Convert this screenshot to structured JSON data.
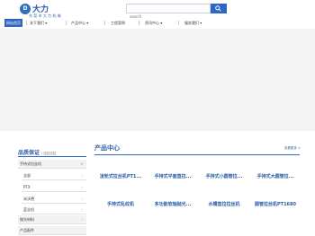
{
  "header": {
    "logo_mark": "D",
    "brand": "大力",
    "tagline": "东 莞 市 大 力 机 械"
  },
  "search": {
    "placeholder": "search"
  },
  "nav": {
    "items": [
      {
        "label": "网站首页",
        "active": true
      },
      {
        "label": "关于我们",
        "dropdown": true
      },
      {
        "label": "产品中心",
        "dropdown": true
      },
      {
        "label": "工程案例"
      },
      {
        "label": "资讯中心",
        "dropdown": true
      },
      {
        "label": "服务我们",
        "dropdown": true
      }
    ]
  },
  "sidebar": {
    "title": "品质保证",
    "subtitle": "/ 拉拉拉拉",
    "rows": [
      {
        "label": "手持式拉丝机",
        "arrow": "▾"
      },
      {
        "label": "全部",
        "arrow": "›"
      },
      {
        "label": "PTX",
        "arrow": "›"
      },
      {
        "label": "米沃德",
        "arrow": "›"
      },
      {
        "label": "拉丝",
        "arrow": "›"
      },
      {
        "label": "蓝全机",
        "arrow": "›"
      },
      {
        "label": "抛光材料",
        "arrow": "›"
      },
      {
        "label": "产品配件",
        "arrow": ""
      }
    ]
  },
  "products": {
    "title": "产品中心",
    "more": "查看更多 >",
    "items": [
      "凌轮式拉丝机PT1...",
      "手持式平面直拉...",
      "手持式小圆管拉...",
      "手持式大圆管拉...",
      "手持式乱纹机",
      "多功能软轴抛光...",
      "水槽直拉拉丝机",
      "圆管拉丝机PT1680"
    ]
  },
  "colors": {
    "accent": "#2e66c4",
    "banner": "#f4f4f4"
  }
}
